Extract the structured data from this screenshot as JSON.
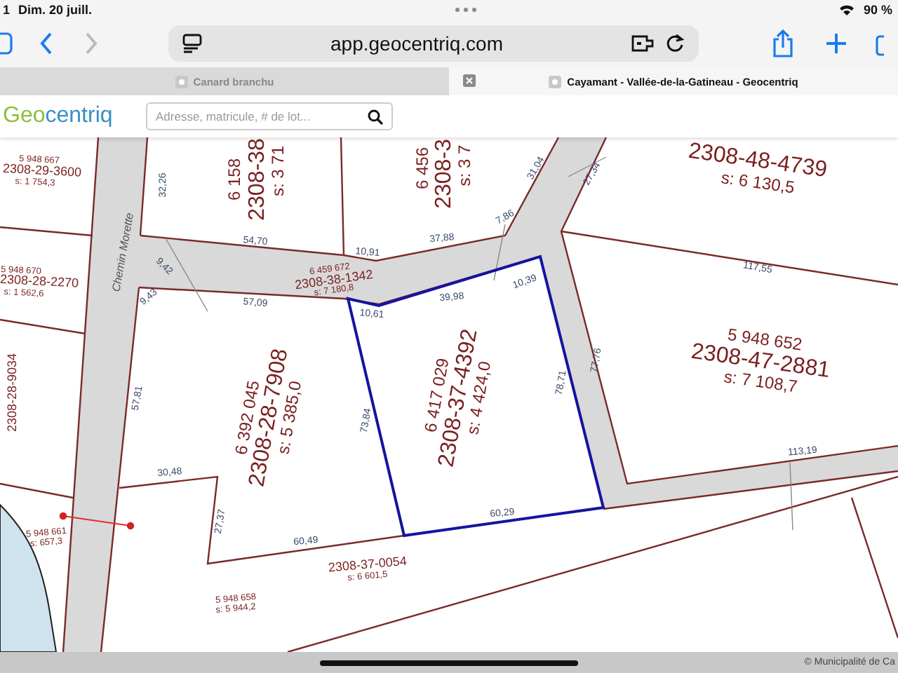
{
  "status_bar": {
    "time": "1",
    "date": "Dim. 20 juill.",
    "battery": "90 %"
  },
  "address_bar": {
    "url": "app.geocentriq.com"
  },
  "tabs": [
    {
      "title": "Canard branchu",
      "selected": false
    },
    {
      "title": "Cayamant - Vallée-de-la-Gatineau - Geocentriq",
      "selected": true
    }
  ],
  "site_header": {
    "logo_part_1": "Geo",
    "logo_part_2": "centriq",
    "search": {
      "placeholder": "Adresse, matricule, # de lot..."
    }
  },
  "map": {
    "labels": [
      {
        "kind": "road",
        "text": "Chemin Morette"
      },
      {
        "kind": "lot_detail",
        "text": "6 158"
      },
      {
        "kind": "lot_number",
        "text": "2308-38"
      },
      {
        "kind": "lot_detail",
        "text": "s: 3 71"
      },
      {
        "kind": "lot_detail",
        "text": "6 456"
      },
      {
        "kind": "lot_number",
        "text": "2308-3"
      },
      {
        "kind": "lot_detail",
        "text": "s: 3 7"
      },
      {
        "kind": "lot_number",
        "text": "2308-48-4739"
      },
      {
        "kind": "lot_detail",
        "text": "s: 6 130,5"
      },
      {
        "kind": "lot_detail",
        "text": "5 948 652"
      },
      {
        "kind": "lot_number",
        "text": "2308-47-2881"
      },
      {
        "kind": "lot_detail",
        "text": "s: 7 108,7"
      },
      {
        "kind": "lot_detail",
        "text": "6 392 045"
      },
      {
        "kind": "lot_number",
        "text": "2308-28-7908"
      },
      {
        "kind": "lot_detail",
        "text": "s: 5 385,0"
      },
      {
        "kind": "lot_detail",
        "text": "6 417 029"
      },
      {
        "kind": "lot_number",
        "text": "2308-37-4392"
      },
      {
        "kind": "lot_detail",
        "text": "s: 4 424,0"
      },
      {
        "kind": "small_detail",
        "text": "5 948 667"
      },
      {
        "kind": "small_lot_number",
        "text": "2308-29-3600"
      },
      {
        "kind": "small_detail",
        "text": "s: 1 754,3"
      },
      {
        "kind": "small_detail",
        "text": "5 948 670"
      },
      {
        "kind": "small_lot_number",
        "text": "2308-28-2270"
      },
      {
        "kind": "small_detail",
        "text": "s: 1 562,6"
      },
      {
        "kind": "small_lot_number",
        "text": "2308-28-9034"
      },
      {
        "kind": "small_detail",
        "text": "6 459 672"
      },
      {
        "kind": "small_lot_number",
        "text": "2308-38-1342"
      },
      {
        "kind": "small_detail",
        "text": "s: 7 180,8"
      },
      {
        "kind": "small_lot_number",
        "text": "2308-37-0054"
      },
      {
        "kind": "small_detail",
        "text": "s: 6 601,5"
      },
      {
        "kind": "small_detail",
        "text": "5 948 661"
      },
      {
        "kind": "small_detail",
        "text": "s: 657,3"
      },
      {
        "kind": "small_detail",
        "text": "5 948 658"
      },
      {
        "kind": "small_detail",
        "text": "s: 5 944,2"
      },
      {
        "kind": "dimension",
        "text": "32,26"
      },
      {
        "kind": "dimension",
        "text": "9,42"
      },
      {
        "kind": "dimension",
        "text": "54,70"
      },
      {
        "kind": "dimension",
        "text": "10,91"
      },
      {
        "kind": "dimension",
        "text": "37,88"
      },
      {
        "kind": "dimension",
        "text": "7,86"
      },
      {
        "kind": "dimension",
        "text": "31,04"
      },
      {
        "kind": "dimension",
        "text": "27,34"
      },
      {
        "kind": "dimension",
        "text": "117,55"
      },
      {
        "kind": "dimension",
        "text": "9,43"
      },
      {
        "kind": "dimension",
        "text": "57,09"
      },
      {
        "kind": "dimension",
        "text": "10,61"
      },
      {
        "kind": "dimension",
        "text": "39,98"
      },
      {
        "kind": "dimension",
        "text": "10,39"
      },
      {
        "kind": "dimension",
        "text": "77,76"
      },
      {
        "kind": "dimension",
        "text": "78,71"
      },
      {
        "kind": "dimension",
        "text": "73,84"
      },
      {
        "kind": "dimension",
        "text": "57,81"
      },
      {
        "kind": "dimension",
        "text": "30,48"
      },
      {
        "kind": "dimension",
        "text": "27,37"
      },
      {
        "kind": "dimension",
        "text": "60,49"
      },
      {
        "kind": "dimension",
        "text": "60,29"
      },
      {
        "kind": "dimension",
        "text": "113,19"
      }
    ]
  },
  "attribution": "© Municipalité de Ca"
}
